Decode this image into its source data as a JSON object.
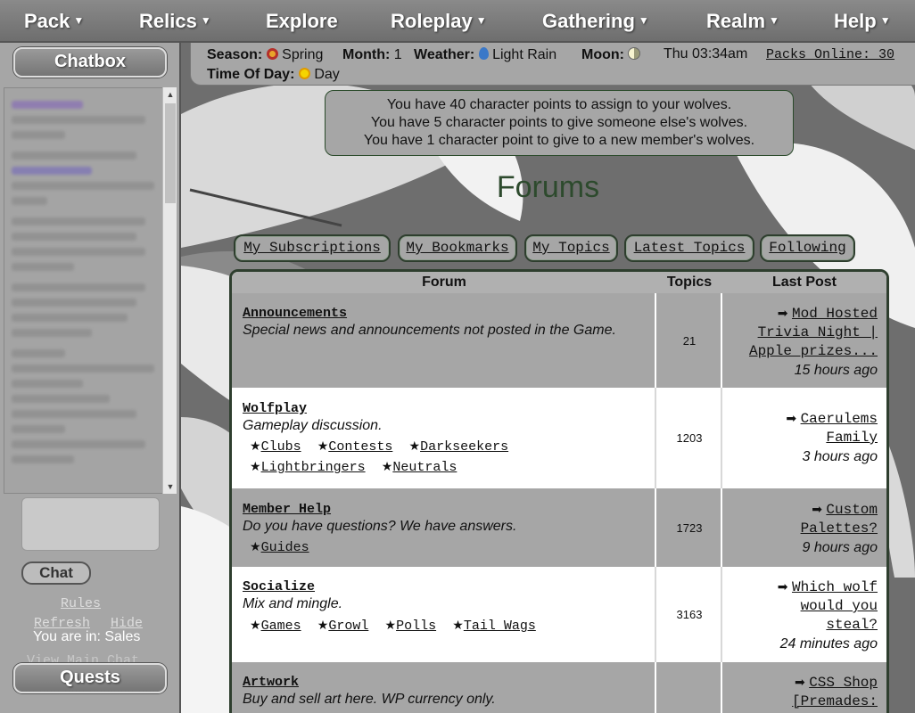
{
  "nav": {
    "items": [
      {
        "label": "Pack",
        "caret": true
      },
      {
        "label": "Relics",
        "caret": true
      },
      {
        "label": "Explore",
        "caret": false
      },
      {
        "label": "Roleplay",
        "caret": true
      },
      {
        "label": "Gathering",
        "caret": true
      },
      {
        "label": "Realm",
        "caret": true
      },
      {
        "label": "Help",
        "caret": true
      }
    ]
  },
  "sidebar": {
    "chatbox_label": "Chatbox",
    "chat_button": "Chat",
    "rules_link": "Rules",
    "refresh_link": "Refresh",
    "hide_link": "Hide",
    "location_text": "You are in: Sales",
    "view_main_link": "View Main Chat",
    "quests_label": "Quests"
  },
  "status": {
    "season_label": "Season:",
    "season_value": "Spring",
    "month_label": "Month:",
    "month_value": "1",
    "weather_label": "Weather:",
    "weather_value": "Light Rain",
    "moon_label": "Moon:",
    "datetime": "Thu 03:34am",
    "packs_online": "Packs Online: 30",
    "tod_label": "Time Of Day:",
    "tod_value": "Day"
  },
  "points": {
    "line1": "You have 40 character points to assign to your wolves.",
    "line2": "You have 5 character points to give someone else's wolves.",
    "line3": "You have 1 character point to give to a new member's wolves."
  },
  "page_title": "Forums",
  "tabs": [
    {
      "label": "My Subscriptions"
    },
    {
      "label": "My Bookmarks"
    },
    {
      "label": "My Topics"
    },
    {
      "label": "Latest Topics"
    },
    {
      "label": "Following"
    }
  ],
  "table": {
    "headers": {
      "forum": "Forum",
      "topics": "Topics",
      "last_post": "Last Post"
    },
    "rows": [
      {
        "name": "Announcements",
        "description": "Special news and announcements not posted in the Game.",
        "subforums": [],
        "topics": "21",
        "last_post_lines": [
          "Mod Hosted",
          "Trivia Night |",
          "Apple prizes..."
        ],
        "last_post_ago": "15 hours ago"
      },
      {
        "name": "Wolfplay",
        "description": "Gameplay discussion.",
        "subforums": [
          "Clubs",
          "Contests",
          "Darkseekers",
          "Lightbringers",
          "Neutrals"
        ],
        "topics": "1203",
        "last_post_lines": [
          "Caerulems",
          "Family"
        ],
        "last_post_ago": "3 hours ago"
      },
      {
        "name": "Member Help",
        "description": "Do you have questions? We have answers.",
        "subforums": [
          "Guides"
        ],
        "topics": "1723",
        "last_post_lines": [
          "Custom",
          "Palettes?"
        ],
        "last_post_ago": "9 hours ago"
      },
      {
        "name": "Socialize",
        "description": "Mix and mingle.",
        "subforums": [
          "Games",
          "Growl",
          "Polls",
          "Tail Wags"
        ],
        "topics": "3163",
        "last_post_lines": [
          "Which wolf",
          "would you",
          "steal?"
        ],
        "last_post_ago": "24 minutes ago"
      },
      {
        "name": "Artwork",
        "description": "Buy and sell art here. WP currency only.",
        "subforums": [],
        "topics": "",
        "last_post_lines": [
          "CSS Shop",
          "[Premades:"
        ],
        "last_post_ago": ""
      }
    ]
  },
  "icons": {
    "star": "★",
    "arrow": "➡",
    "caret": "▼"
  }
}
